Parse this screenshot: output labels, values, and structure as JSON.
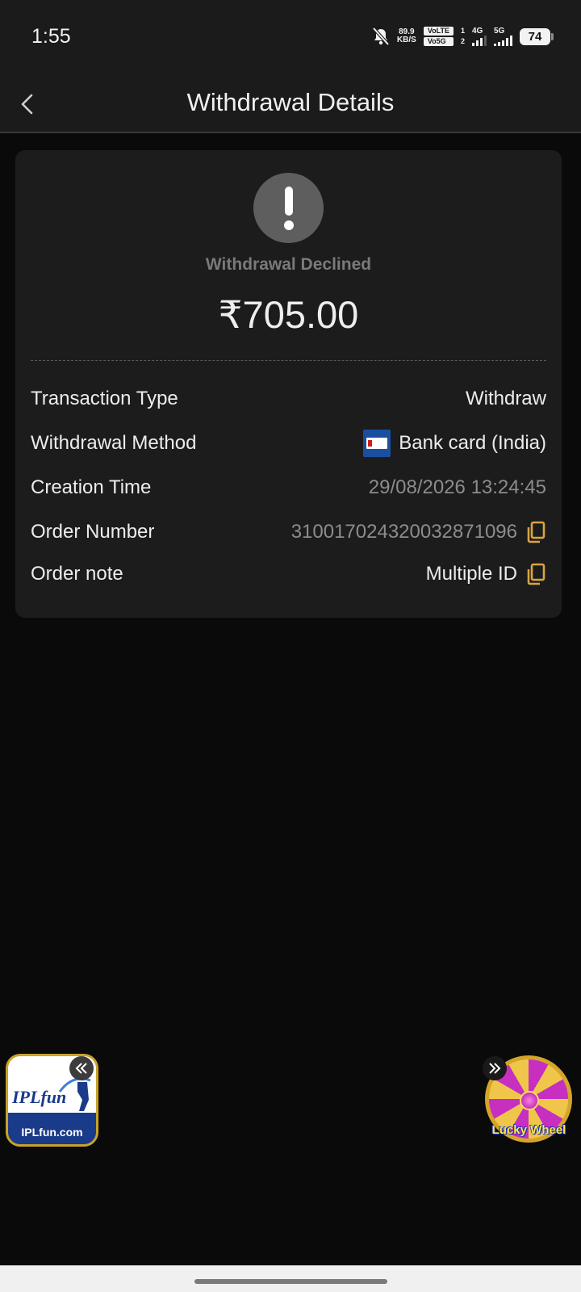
{
  "status_bar": {
    "time": "1:55",
    "speed_value": "89.9",
    "speed_unit": "KB/S",
    "volte_top": "VoLTE",
    "volte_bottom": "Vo5G",
    "sim_1": "1",
    "sim_2": "2",
    "net_1": "4G",
    "net_2": "5G",
    "battery": "74"
  },
  "header": {
    "title": "Withdrawal Details",
    "back_icon": "chevron-left-icon"
  },
  "summary": {
    "status_icon": "exclamation-icon",
    "status_text": "Withdrawal Declined",
    "amount": "₹705.00"
  },
  "details": {
    "transaction_type": {
      "label": "Transaction Type",
      "value": "Withdraw"
    },
    "withdrawal_method": {
      "label": "Withdrawal Method",
      "value": "Bank card (India)"
    },
    "creation_time": {
      "label": "Creation Time",
      "value": "29/08/2026 13:24:45"
    },
    "order_number": {
      "label": "Order Number",
      "value": "310017024320032871096"
    },
    "order_note": {
      "label": "Order note",
      "value": "Multiple ID"
    }
  },
  "floating": {
    "left_logo_text": "IPLfun",
    "left_site": "IPLfun.com",
    "right_label": "Lucky Wheel"
  },
  "colors": {
    "background": "#0a0a0a",
    "card": "#1c1c1c",
    "copy_icon": "#d9a441",
    "status_icon_bg": "#5e5e5e"
  }
}
